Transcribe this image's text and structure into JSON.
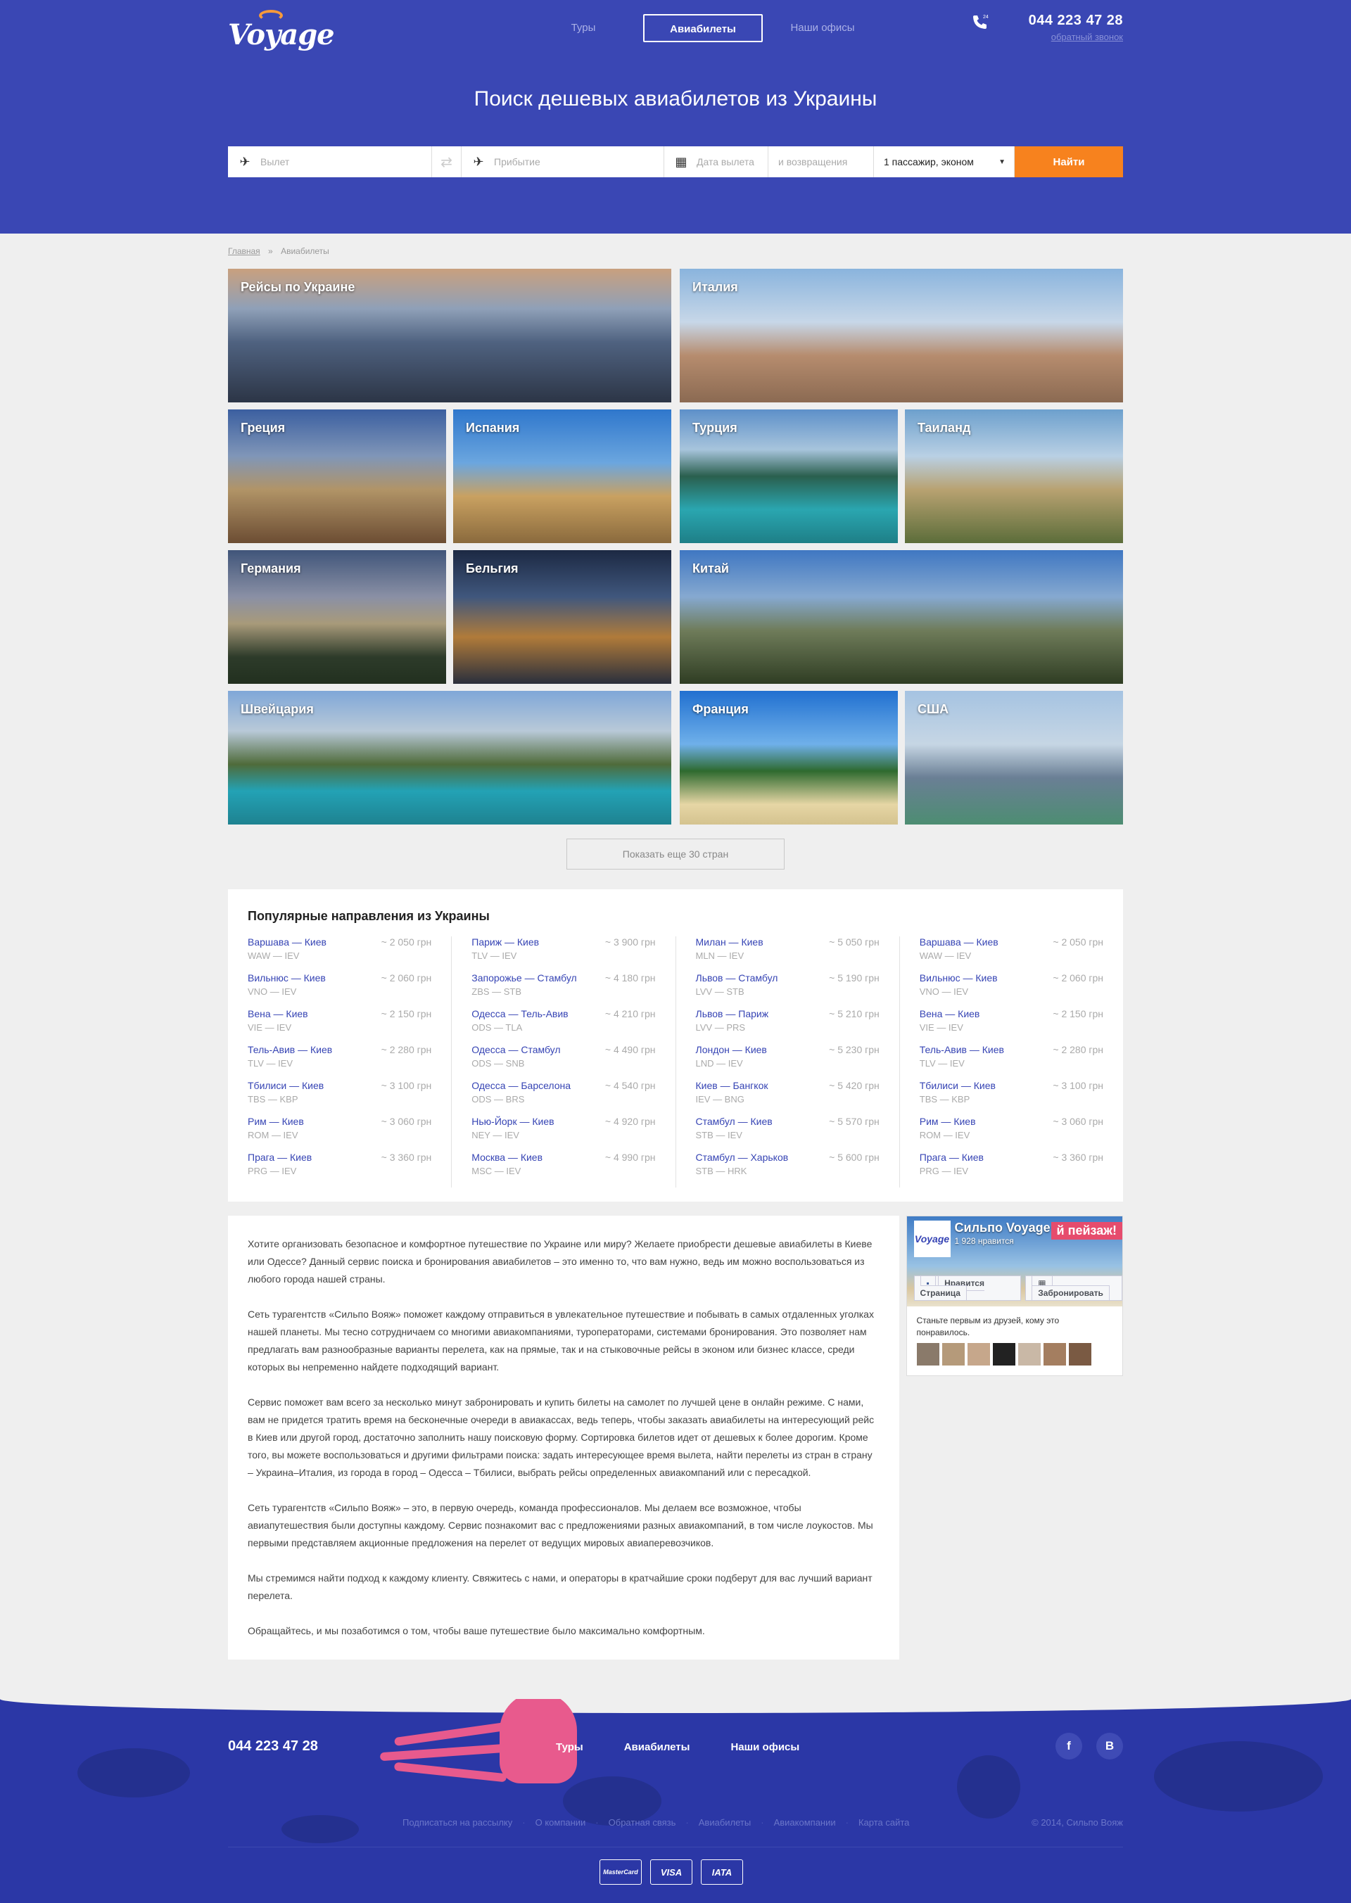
{
  "brand": {
    "logo_text": "Voyage",
    "accent": "#f7821e",
    "primary": "#3a47b4"
  },
  "nav": {
    "items": [
      {
        "label": "Туры",
        "active": false
      },
      {
        "label": "Авиабилеты",
        "active": true
      },
      {
        "label": "Наши офисы",
        "active": false
      }
    ]
  },
  "contact": {
    "phone": "044 223 47 28",
    "callback": "обратный звонок",
    "phone_badge": "24"
  },
  "hero": {
    "title": "Поиск дешевых авиабилетов из Украины"
  },
  "search": {
    "from_placeholder": "Вылет",
    "to_placeholder": "Прибытие",
    "date_placeholder": "Дата вылета",
    "return_placeholder": "и возвращения",
    "passengers_value": "1 пассажир, эконом",
    "submit_label": "Найти"
  },
  "breadcrumb": {
    "home": "Главная",
    "separator": "»",
    "current": "Авиабилеты"
  },
  "destinations": [
    {
      "label": "Рейсы по Украине"
    },
    {
      "label": "Италия"
    },
    {
      "label": "Греция"
    },
    {
      "label": "Испания"
    },
    {
      "label": "Турция"
    },
    {
      "label": "Таиланд"
    },
    {
      "label": "Германия"
    },
    {
      "label": "Бельгия"
    },
    {
      "label": "Китай"
    },
    {
      "label": "Швейцария"
    },
    {
      "label": "Франция"
    },
    {
      "label": "США"
    }
  ],
  "more_button": "Показать еще 30 стран",
  "popular": {
    "title": "Популярные направления из Украины",
    "columns": [
      [
        {
          "route": "Варшава — Киев",
          "codes": "WAW — IEV",
          "price": "~ 2 050 грн"
        },
        {
          "route": "Вильнюс — Киев",
          "codes": "VNO — IEV",
          "price": "~ 2 060 грн"
        },
        {
          "route": "Вена — Киев",
          "codes": "VIE — IEV",
          "price": "~ 2 150 грн"
        },
        {
          "route": "Тель-Авив — Киев",
          "codes": "TLV — IEV",
          "price": "~ 2 280 грн"
        },
        {
          "route": "Тбилиси — Киев",
          "codes": "TBS — KBP",
          "price": "~ 3 100 грн"
        },
        {
          "route": "Рим — Киев",
          "codes": "ROM — IEV",
          "price": "~ 3 060 грн"
        },
        {
          "route": "Прага — Киев",
          "codes": "PRG — IEV",
          "price": "~ 3 360 грн"
        }
      ],
      [
        {
          "route": "Париж — Киев",
          "codes": "TLV — IEV",
          "price": "~ 3 900 грн"
        },
        {
          "route": "Запорожье — Стамбул",
          "codes": "ZBS — STB",
          "price": "~ 4 180 грн"
        },
        {
          "route": "Одесса — Тель-Авив",
          "codes": "ODS — TLA",
          "price": "~ 4 210 грн"
        },
        {
          "route": "Одесса — Стамбул",
          "codes": "ODS — SNB",
          "price": "~ 4 490 грн"
        },
        {
          "route": "Одесса — Барселона",
          "codes": "ODS — BRS",
          "price": "~ 4 540 грн"
        },
        {
          "route": "Нью-Йорк — Киев",
          "codes": "NEY — IEV",
          "price": "~ 4 920 грн"
        },
        {
          "route": "Москва — Киев",
          "codes": "MSC — IEV",
          "price": "~ 4 990 грн"
        }
      ],
      [
        {
          "route": "Милан — Киев",
          "codes": "MLN — IEV",
          "price": "~ 5 050 грн"
        },
        {
          "route": "Львов — Стамбул",
          "codes": "LVV — STB",
          "price": "~ 5 190 грн"
        },
        {
          "route": "Львов — Париж",
          "codes": "LVV — PRS",
          "price": "~ 5 210 грн"
        },
        {
          "route": "Лондон — Киев",
          "codes": "LND — IEV",
          "price": "~ 5 230 грн"
        },
        {
          "route": "Киев — Бангкок",
          "codes": "IEV — BNG",
          "price": "~ 5 420 грн"
        },
        {
          "route": "Стамбул — Киев",
          "codes": "STB — IEV",
          "price": "~ 5 570 грн"
        },
        {
          "route": "Стамбул — Харьков",
          "codes": "STB — HRK",
          "price": "~ 5 600 грн"
        }
      ],
      [
        {
          "route": "Варшава — Киев",
          "codes": "WAW — IEV",
          "price": "~ 2 050 грн"
        },
        {
          "route": "Вильнюс — Киев",
          "codes": "VNO — IEV",
          "price": "~ 2 060 грн"
        },
        {
          "route": "Вена — Киев",
          "codes": "VIE — IEV",
          "price": "~ 2 150 грн"
        },
        {
          "route": "Тель-Авив — Киев",
          "codes": "TLV — IEV",
          "price": "~ 2 280 грн"
        },
        {
          "route": "Тбилиси — Киев",
          "codes": "TBS — KBP",
          "price": "~ 3 100 грн"
        },
        {
          "route": "Рим — Киев",
          "codes": "ROM — IEV",
          "price": "~ 3 060 грн"
        },
        {
          "route": "Прага — Киев",
          "codes": "PRG — IEV",
          "price": "~ 3 360 грн"
        }
      ]
    ]
  },
  "article": {
    "paragraphs": [
      "Хотите организовать безопасное и комфортное путешествие по Украине или миру? Желаете приобрести дешевые авиабилеты в Киеве или Одессе? Данный сервис поиска и бронирования авиабилетов – это именно то, что вам нужно, ведь им можно воспользоваться из любого города нашей страны.",
      "Сеть турагентств «Сильпо Вояж» поможет каждому отправиться в увлекательное путешествие и побывать в самых отдаленных уголках нашей планеты. Мы тесно сотрудничаем со многими авиакомпаниями, туроператорами, системами бронирования. Это позволяет нам предлагать вам разнообразные варианты перелета, как на прямые, так и на стыковочные рейсы в эконом или бизнес классе, среди которых вы непременно найдете подходящий вариант.",
      "Сервис поможет вам всего за несколько минут забронировать и купить билеты на самолет по лучшей цене в онлайн режиме. С нами, вам не придется тратить время на бесконечные очереди в авиакассах, ведь теперь, чтобы заказать авиабилеты на интересующий рейс в Киев или другой город, достаточно заполнить нашу поисковую форму. Сортировка билетов идет от дешевых к более дорогим. Кроме того, вы можете воспользоваться и другими фильтрами поиска: задать интересующее время вылета, найти перелеты из стран в страну – Украина–Италия, из города в город – Одесса – Тбилиси, выбрать рейсы определенных авиакомпаний или с пересадкой.",
      "Сеть турагентств «Сильпо Вояж» – это, в первую очередь, команда профессионалов. Мы делаем все возможное, чтобы авиапутешествия были доступны каждому. Сервис познакомит вас с предложениями разных авиакомпаний, в том числе лоукостов. Мы первыми представляем акционные предложения на перелет от ведущих мировых авиаперевозчиков.",
      "Мы стремимся найти подход к каждому клиенту. Свяжитесь с нами, и операторы в кратчайшие сроки подберут для вас лучший вариант перелета.",
      "Обращайтесь, и мы позаботимся о том, чтобы ваше путешествие было максимально комфортным."
    ]
  },
  "fb_widget": {
    "page_name": "Сильпо Voyage",
    "likes": "1 928 нравится",
    "cover_text": "й пейзаж!",
    "like_button": "Нравится Страница",
    "book_button": "Забронировать",
    "friends_text": "Станьте первым из друзей, кому это понравилось."
  },
  "footer": {
    "phone": "044 223 47 28",
    "nav": [
      "Туры",
      "Авиабилеты",
      "Наши офисы"
    ],
    "social": [
      "f",
      "В"
    ],
    "links": [
      "Подписаться на рассылку",
      "О компании",
      "Обратная связь",
      "Авиабилеты",
      "Авиакомпании",
      "Карта сайта"
    ],
    "copyright": "© 2014, Сильпо Вояж",
    "payments": [
      "MasterCard",
      "VISA",
      "IATA"
    ]
  }
}
